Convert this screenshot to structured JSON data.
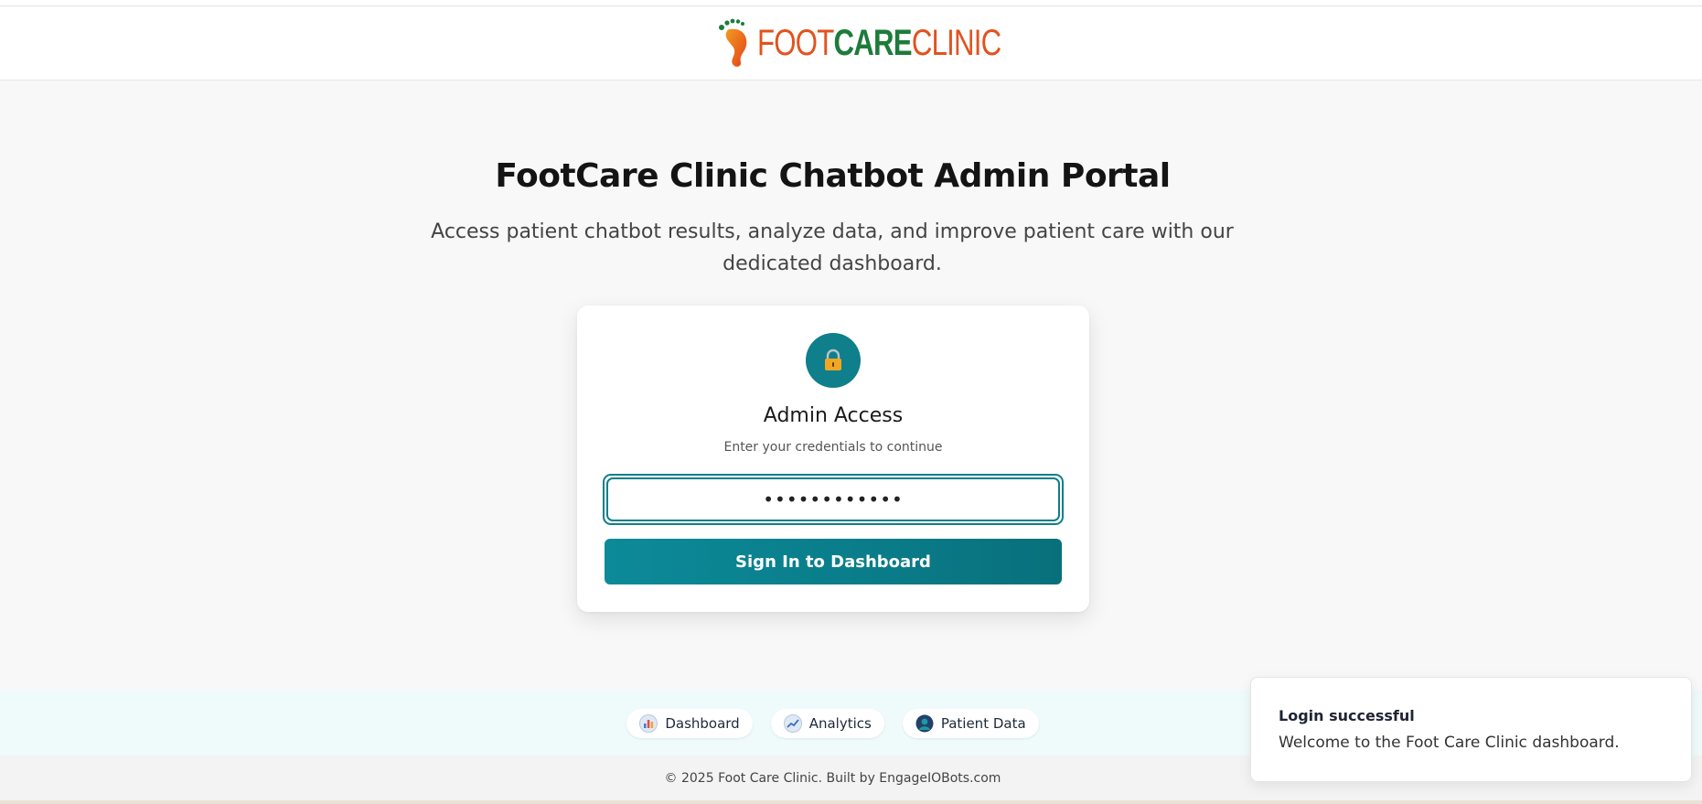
{
  "header": {
    "logo": {
      "part1": "FOOT",
      "part2": "CARE",
      "part3": "CLINIC"
    }
  },
  "hero": {
    "title": "FootCare Clinic Chatbot Admin Portal",
    "subtitle": "Access patient chatbot results, analyze data, and improve patient care with our dedicated dashboard."
  },
  "login_card": {
    "icon": "lock-icon",
    "title": "Admin Access",
    "subtitle": "Enter your credentials to continue",
    "password_value": "••••••••••••",
    "button_label": "Sign In to Dashboard"
  },
  "nav": {
    "items": [
      {
        "label": "Dashboard",
        "icon": "bar-chart-icon"
      },
      {
        "label": "Analytics",
        "icon": "trend-chart-icon"
      },
      {
        "label": "Patient Data",
        "icon": "user-icon"
      }
    ]
  },
  "footer": {
    "text": "© 2025 Foot Care Clinic. Built by EngageIOBots.com"
  },
  "toast": {
    "title": "Login successful",
    "message": "Welcome to the Foot Care Clinic dashboard."
  },
  "colors": {
    "primary": "#0e7f8b",
    "logo_orange": "#e2521f",
    "logo_green": "#1e7b3a",
    "nav_band": "#effafb"
  }
}
